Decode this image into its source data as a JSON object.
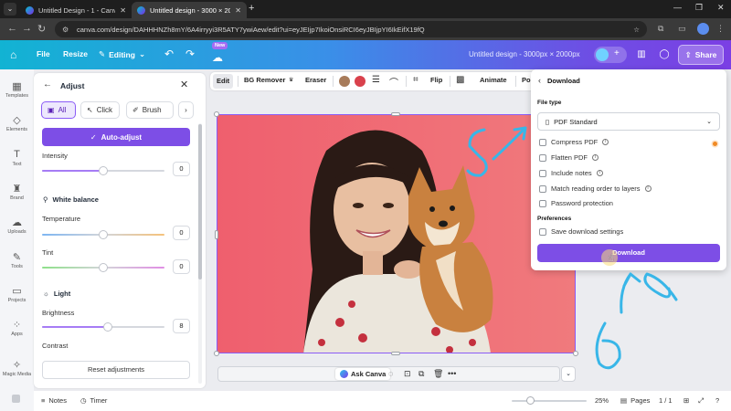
{
  "browser": {
    "tabs": [
      {
        "title": "Untitled Design - 1 - Canva",
        "active": false
      },
      {
        "title": "Untitled design - 3000 × 2000p",
        "active": true
      }
    ],
    "url": "canva.com/design/DAHHHNZh8mY/6A4irryyi3R5ATY7ywiAew/edit?ui=eyJEIjp7IkoiOnsiRCI6eyJBIjpYI6IkEifX19fQ"
  },
  "canva_bar": {
    "file": "File",
    "resize": "Resize",
    "editing": "Editing",
    "new_badge": "New",
    "doc_name": "Untitled design - 3000px × 2000px",
    "share": "Share",
    "brand_color": "#7d4ee6"
  },
  "rail": [
    {
      "icon": "templates-icon",
      "label": "Templates"
    },
    {
      "icon": "elements-icon",
      "label": "Elements"
    },
    {
      "icon": "text-icon",
      "label": "Text"
    },
    {
      "icon": "brand-icon",
      "label": "Brand"
    },
    {
      "icon": "uploads-icon",
      "label": "Uploads"
    },
    {
      "icon": "tools-icon",
      "label": "Tools"
    },
    {
      "icon": "projects-icon",
      "label": "Projects"
    },
    {
      "icon": "apps-icon",
      "label": "Apps"
    },
    {
      "icon": "magic-media-icon",
      "label": "Magic Media"
    }
  ],
  "adjust": {
    "title": "Adjust",
    "modes": [
      "All",
      "Click",
      "Brush"
    ],
    "auto_adjust": "Auto-adjust",
    "intensity": {
      "label": "Intensity",
      "value": "0",
      "level": 0.5
    },
    "white_balance": "White balance",
    "temperature": {
      "label": "Temperature",
      "value": "0",
      "level": 0.5
    },
    "tint": {
      "label": "Tint",
      "value": "0",
      "level": 0.5
    },
    "light": "Light",
    "brightness": {
      "label": "Brightness",
      "value": "8",
      "level": 0.54
    },
    "contrast": {
      "label": "Contrast"
    },
    "reset": "Reset adjustments"
  },
  "context_toolbar": {
    "edit": "Edit",
    "bg_remover": "BG Remover",
    "eraser": "Eraser",
    "flip": "Flip",
    "animate": "Animate",
    "position": "Po",
    "swatches": [
      "#a77b5a",
      "#d9414c"
    ]
  },
  "ask_canva": "Ask Canva",
  "bottom": {
    "notes": "Notes",
    "timer": "Timer",
    "zoom": "25%",
    "pages": "Pages",
    "page_count": "1 / 1"
  },
  "download": {
    "title": "Download",
    "file_type_label": "File type",
    "file_type": "PDF Standard",
    "options": [
      {
        "label": "Compress PDF",
        "info": true
      },
      {
        "label": "Flatten PDF",
        "info": true
      },
      {
        "label": "Include notes",
        "info": true
      },
      {
        "label": "Match reading order to layers",
        "info": true
      },
      {
        "label": "Password protection",
        "info": false
      }
    ],
    "preferences_label": "Preferences",
    "save_settings": "Save download settings",
    "button": "Download",
    "handwritten_numbers": [
      "5",
      "6"
    ]
  }
}
